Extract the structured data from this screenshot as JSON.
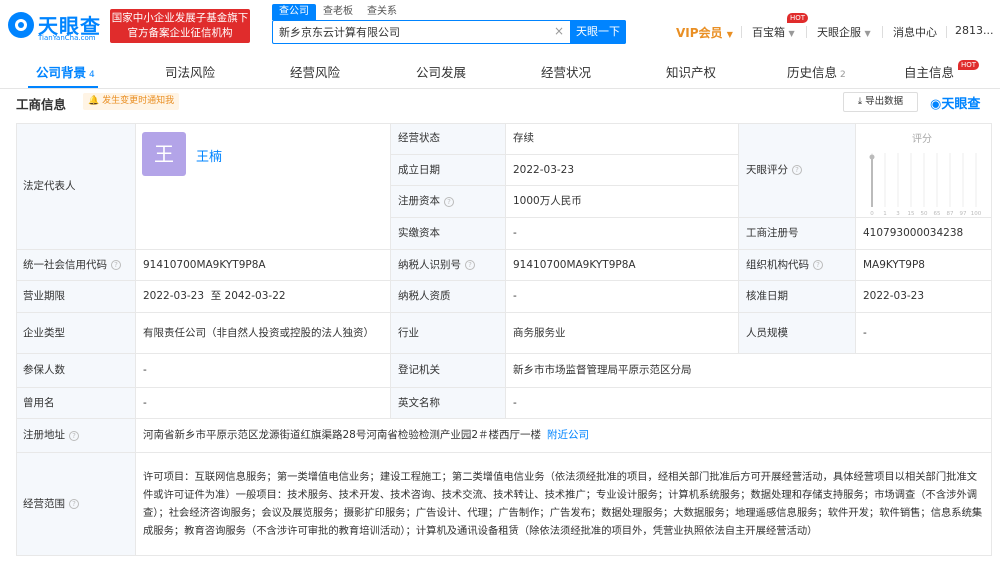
{
  "header": {
    "logo_text": "天眼查",
    "logo_url": "TianYanCha.com",
    "gov_badge_line1": "国家中小企业发展子基金旗下",
    "gov_badge_line2": "官方备案企业征信机构",
    "search_tabs": [
      "查公司",
      "查老板",
      "查关系"
    ],
    "search_value": "新乡京东云计算有限公司",
    "search_button": "天眼一下",
    "clear_icon": "×",
    "vip": "VIP会员",
    "toolbox": "百宝箱",
    "hot": "HOT",
    "enterprise": "天眼企服",
    "messages": "消息中心",
    "user": "2813..."
  },
  "tabs": [
    {
      "label": "公司背景",
      "count": "4"
    },
    {
      "label": "司法风险",
      "count": ""
    },
    {
      "label": "经营风险",
      "count": ""
    },
    {
      "label": "公司发展",
      "count": ""
    },
    {
      "label": "经营状况",
      "count": ""
    },
    {
      "label": "知识产权",
      "count": ""
    },
    {
      "label": "历史信息",
      "count": "2"
    },
    {
      "label": "自主信息",
      "count": ""
    }
  ],
  "section": {
    "title": "工商信息",
    "notify": "发生变更时通知我",
    "export": "导出数据",
    "brand": "天眼查"
  },
  "info": {
    "legal_rep_label": "法定代表人",
    "legal_rep_avatar": "王",
    "legal_rep_name": "王楠",
    "status_label": "经营状态",
    "status_value": "存续",
    "founded_label": "成立日期",
    "founded_value": "2022-03-23",
    "reg_capital_label": "注册资本",
    "reg_capital_value": "1000万人民币",
    "paid_capital_label": "实缴资本",
    "paid_capital_value": "-",
    "score_label": "天眼评分",
    "score_title": "评分",
    "score_ticks": [
      "0",
      "1",
      "3",
      "15",
      "50",
      "65",
      "87",
      "97",
      "100"
    ],
    "reg_no_label": "工商注册号",
    "reg_no_value": "410793000034238",
    "credit_code_label": "统一社会信用代码",
    "credit_code_value": "91410700MA9KYT9P8A",
    "taxpayer_id_label": "纳税人识别号",
    "taxpayer_id_value": "91410700MA9KYT9P8A",
    "org_code_label": "组织机构代码",
    "org_code_value": "MA9KYT9P8",
    "term_label": "营业期限",
    "term_value": "2022-03-23  至 2042-03-22",
    "taxpayer_qual_label": "纳税人资质",
    "taxpayer_qual_value": "-",
    "approve_label": "核准日期",
    "approve_value": "2022-03-23",
    "type_label": "企业类型",
    "type_value": "有限责任公司（非自然人投资或控股的法人独资）",
    "industry_label": "行业",
    "industry_value": "商务服务业",
    "staff_label": "人员规模",
    "staff_value": "-",
    "insured_label": "参保人数",
    "insured_value": "-",
    "authority_label": "登记机关",
    "authority_value": "新乡市市场监督管理局平原示范区分局",
    "former_name_label": "曾用名",
    "former_name_value": "-",
    "en_name_label": "英文名称",
    "en_name_value": "-",
    "address_label": "注册地址",
    "address_value": "河南省新乡市平原示范区龙源街道红旗渠路28号河南省检验检测产业园2＃楼西厅一楼",
    "address_link": "附近公司",
    "scope_label": "经营范围",
    "scope_value": "许可项目：互联网信息服务；第一类增值电信业务；建设工程施工；第二类增值电信业务（依法须经批准的项目，经相关部门批准后方可开展经营活动，具体经营项目以相关部门批准文件或许可证件为准）一般项目：技术服务、技术开发、技术咨询、技术交流、技术转让、技术推广；专业设计服务；计算机系统服务；数据处理和存储支持服务；市场调查（不含涉外调查）；社会经济咨询服务；会议及展览服务；摄影扩印服务；广告设计、代理；广告制作；广告发布；数据处理服务；大数据服务；地理遥感信息服务；软件开发；软件销售；信息系统集成服务；教育咨询服务（不含涉许可审批的教育培训活动）；计算机及通讯设备租赁（除依法须经批准的项目外，凭营业执照依法自主开展经营活动）"
  },
  "colors": {
    "brand": "#0084ff",
    "label_bg": "#f5f8fc",
    "vip": "#e98f24",
    "hot": "#e02c2c",
    "avatar": "#b3a4e8"
  }
}
